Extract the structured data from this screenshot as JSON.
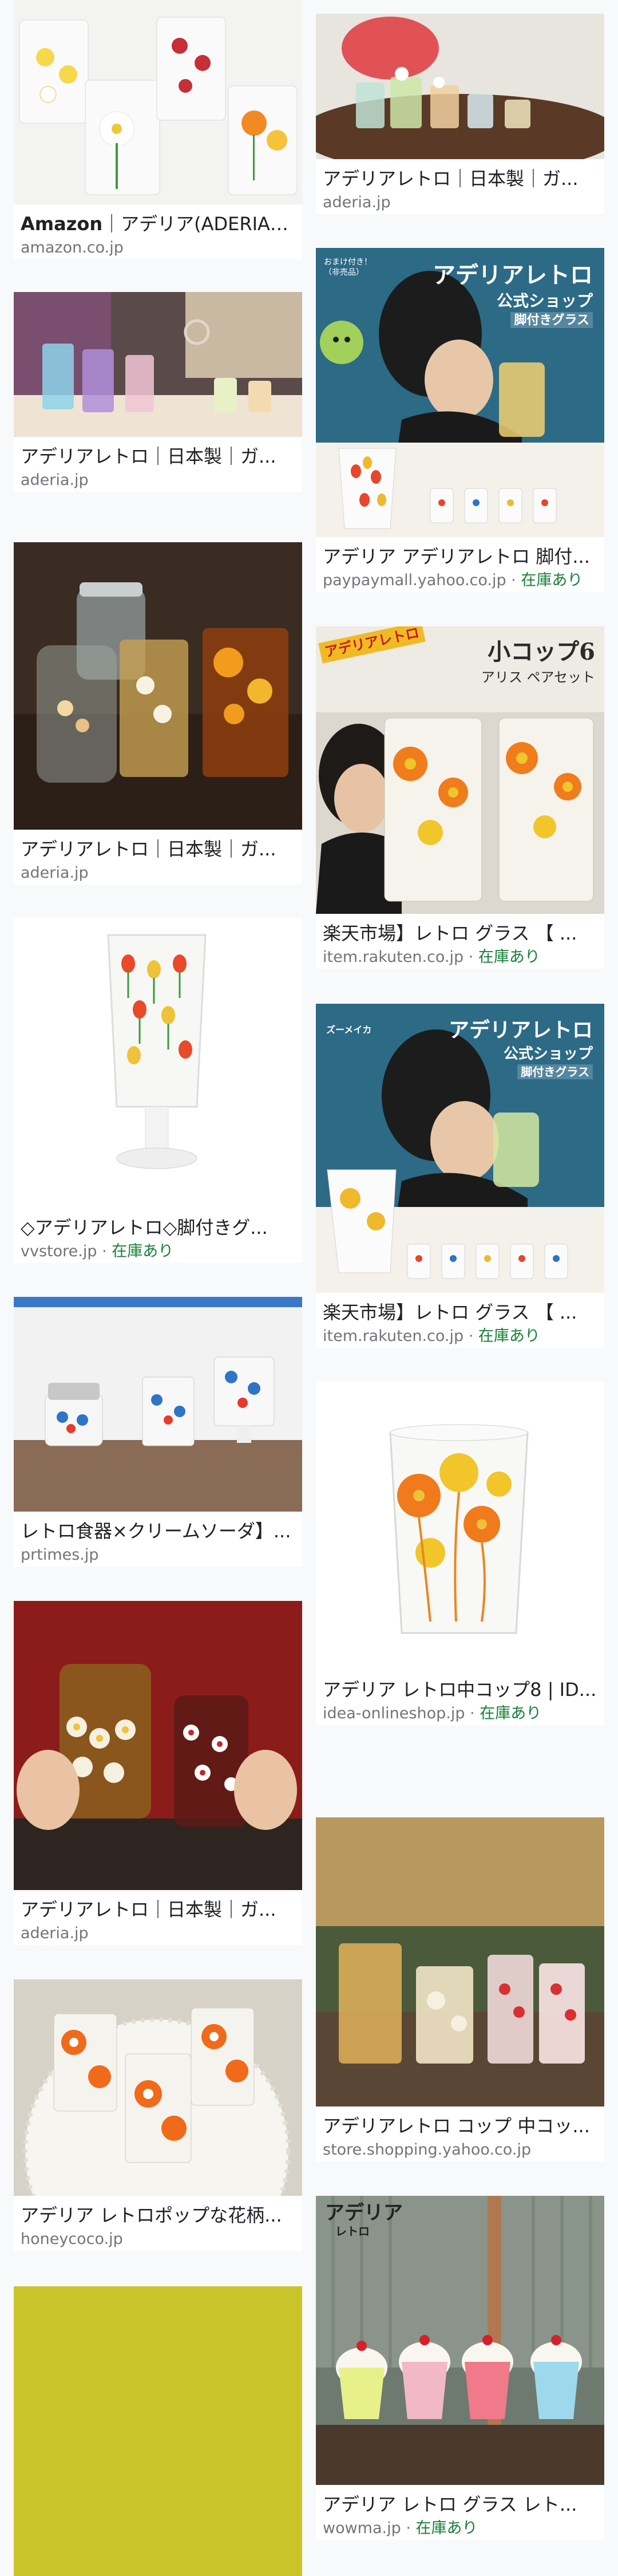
{
  "results": {
    "left": [
      {
        "title": "Amazon｜アデリア(ADERIA) ...",
        "source": "amazon.co.jp",
        "stock": "",
        "image": "daisy-glasses-image",
        "bold_prefix": "Amazon"
      },
      {
        "title": "アデリアレトロ｜日本製｜ガ...",
        "source": "aderia.jp",
        "stock": "",
        "image": "cream-soda-glasses-image"
      },
      {
        "title": "アデリアレトロ｜日本製｜ガ...",
        "source": "aderia.jp",
        "stock": "",
        "image": "tea-glasses-image"
      },
      {
        "title": "◇アデリアレトロ◇脚付きグ...",
        "source": "vvstore.jp",
        "stock": "在庫あり",
        "image": "tulip-footed-glass-image"
      },
      {
        "title": "レトロ食器×クリームソーダ】...",
        "source": "prtimes.jp",
        "stock": "",
        "image": "blue-tulip-set-image"
      },
      {
        "title": "アデリアレトロ｜日本製｜ガ...",
        "source": "aderia.jp",
        "stock": "",
        "image": "hands-holding-glasses-image"
      },
      {
        "title": "アデリア レトロポップな花柄...",
        "source": "honeycoco.jp",
        "stock": "",
        "image": "orange-flower-glasses-image"
      },
      {
        "title": "",
        "source": "",
        "stock": "",
        "image": "loading-placeholder-image"
      }
    ],
    "right": [
      {
        "title": "アデリアレトロ｜日本製｜ガ...",
        "source": "aderia.jp",
        "stock": "",
        "image": "tray-glasses-image"
      },
      {
        "title": "アデリア アデリアレトロ 脚付...",
        "source": "paypaymall.yahoo.co.jp",
        "stock": "在庫あり",
        "image": "shop-banner-image",
        "overlay": {
          "line1": "アデリアレトロ",
          "line2": "公式ショップ",
          "line3": "脚付きグラス",
          "badge": "おまけ付き！（非売品）"
        }
      },
      {
        "title": "楽天市場】レトロ グラス 【 ...",
        "source": "item.rakuten.co.jp",
        "stock": "在庫あり",
        "image": "komug6-image",
        "overlay": {
          "badge": "アデリアレトロ",
          "line1": "小コップ6",
          "line2": "アリス ペアセット"
        }
      },
      {
        "title": "楽天市場】レトロ グラス 【 ...",
        "source": "item.rakuten.co.jp",
        "stock": "在庫あり",
        "image": "shop-banner-image-2",
        "overlay": {
          "line1": "アデリアレトロ",
          "line2": "公式ショップ",
          "line3": "脚付きグラス",
          "badge": "ズーメイカ"
        }
      },
      {
        "title": "アデリア レトロ中コップ8 | ID...",
        "source": "idea-onlineshop.jp",
        "stock": "在庫あり",
        "image": "orange-daisy-glass-image"
      },
      {
        "title": "アデリアレトロ コップ 中コッ...",
        "source": "store.shopping.yahoo.co.jp",
        "stock": "",
        "image": "glasses-by-window-image"
      },
      {
        "title": "アデリア レトロ グラス レト...",
        "source": "wowma.jp",
        "stock": "在庫あり",
        "image": "cream-soda-parfait-image",
        "overlay": {
          "line1": "アデリア",
          "line2": "レトロ"
        }
      }
    ]
  },
  "separator": "·",
  "colors": {
    "stock_green": "#188038",
    "source_gray": "#70757a",
    "title": "#202124",
    "background": "#f8f9fa"
  }
}
